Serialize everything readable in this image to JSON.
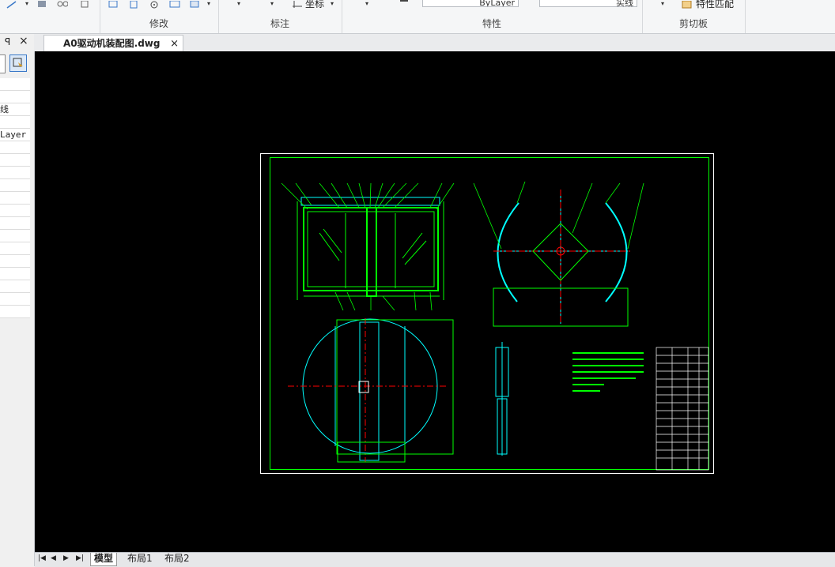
{
  "ribbon": {
    "groups": [
      {
        "label": "修改"
      },
      {
        "label": "标注"
      },
      {
        "label": "特性"
      },
      {
        "label": "剪切板"
      }
    ],
    "annotate_coord_label": "坐标",
    "prop_layer_value": "ByLayer",
    "prop_linetype_value": "实线",
    "paste_match_label": "特性匹配"
  },
  "left_panel": {
    "pin_glyph": "ꟼ",
    "close_glyph": "×",
    "rows": [
      "",
      "",
      "线",
      "",
      "Layer",
      "",
      "",
      "",
      "",
      "",
      "",
      "",
      "",
      "",
      "",
      "",
      "",
      "",
      ""
    ]
  },
  "document": {
    "tab_title": "A0驱动机装配图.dwg",
    "close_glyph": "×"
  },
  "layout_tabs": {
    "nav": [
      "|◀",
      "◀",
      "▶",
      "▶|"
    ],
    "tabs": [
      "模型",
      "布局1",
      "布局2"
    ],
    "active": "模型"
  },
  "colors": {
    "viewport_bg": "#000000",
    "sheet_border": "#ffffff",
    "drawing_green": "#00ff00",
    "drawing_cyan": "#00ffff",
    "centerline_red": "#ff0000"
  }
}
